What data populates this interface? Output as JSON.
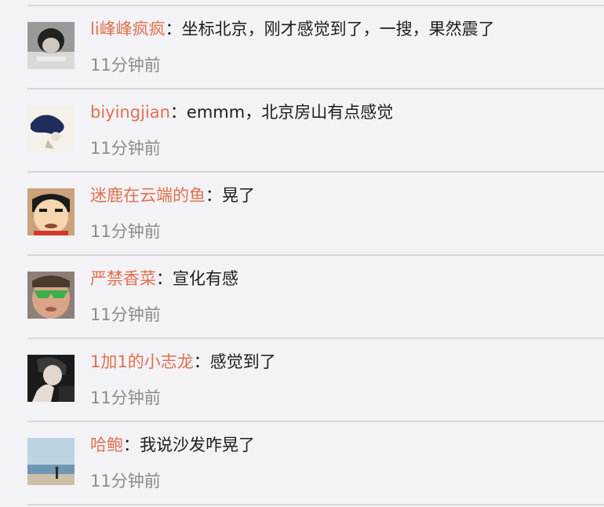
{
  "colors": {
    "background": "#f2f2f7",
    "username": "#e0714e",
    "text": "#1d1d1f",
    "time": "#8b8b8f",
    "divider": "#d8d8dc"
  },
  "comments": [
    {
      "username": "li峰峰疯疯",
      "separator": "：",
      "text": "坐标北京，刚才感觉到了，一搜，果然震了",
      "time": "11分钟前",
      "avatar": "avatar-girl-photo"
    },
    {
      "username": "biyingjian",
      "separator": "：",
      "text": "emmm，北京房山有点感觉",
      "time": "11分钟前",
      "avatar": "avatar-abstract-blue"
    },
    {
      "username": "迷鹿在云端的鱼",
      "separator": "：",
      "text": "晃了",
      "time": "11分钟前",
      "avatar": "avatar-cartoon-face"
    },
    {
      "username": "严禁香菜",
      "separator": "：",
      "text": "宣化有感",
      "time": "11分钟前",
      "avatar": "avatar-man-sunglasses"
    },
    {
      "username": "1加1的小志龙",
      "separator": "：",
      "text": "感觉到了",
      "time": "11分钟前",
      "avatar": "avatar-dark-selfie"
    },
    {
      "username": "哈鲍",
      "separator": "：",
      "text": "我说沙发咋晃了",
      "time": "11分钟前",
      "avatar": "avatar-beach"
    }
  ]
}
